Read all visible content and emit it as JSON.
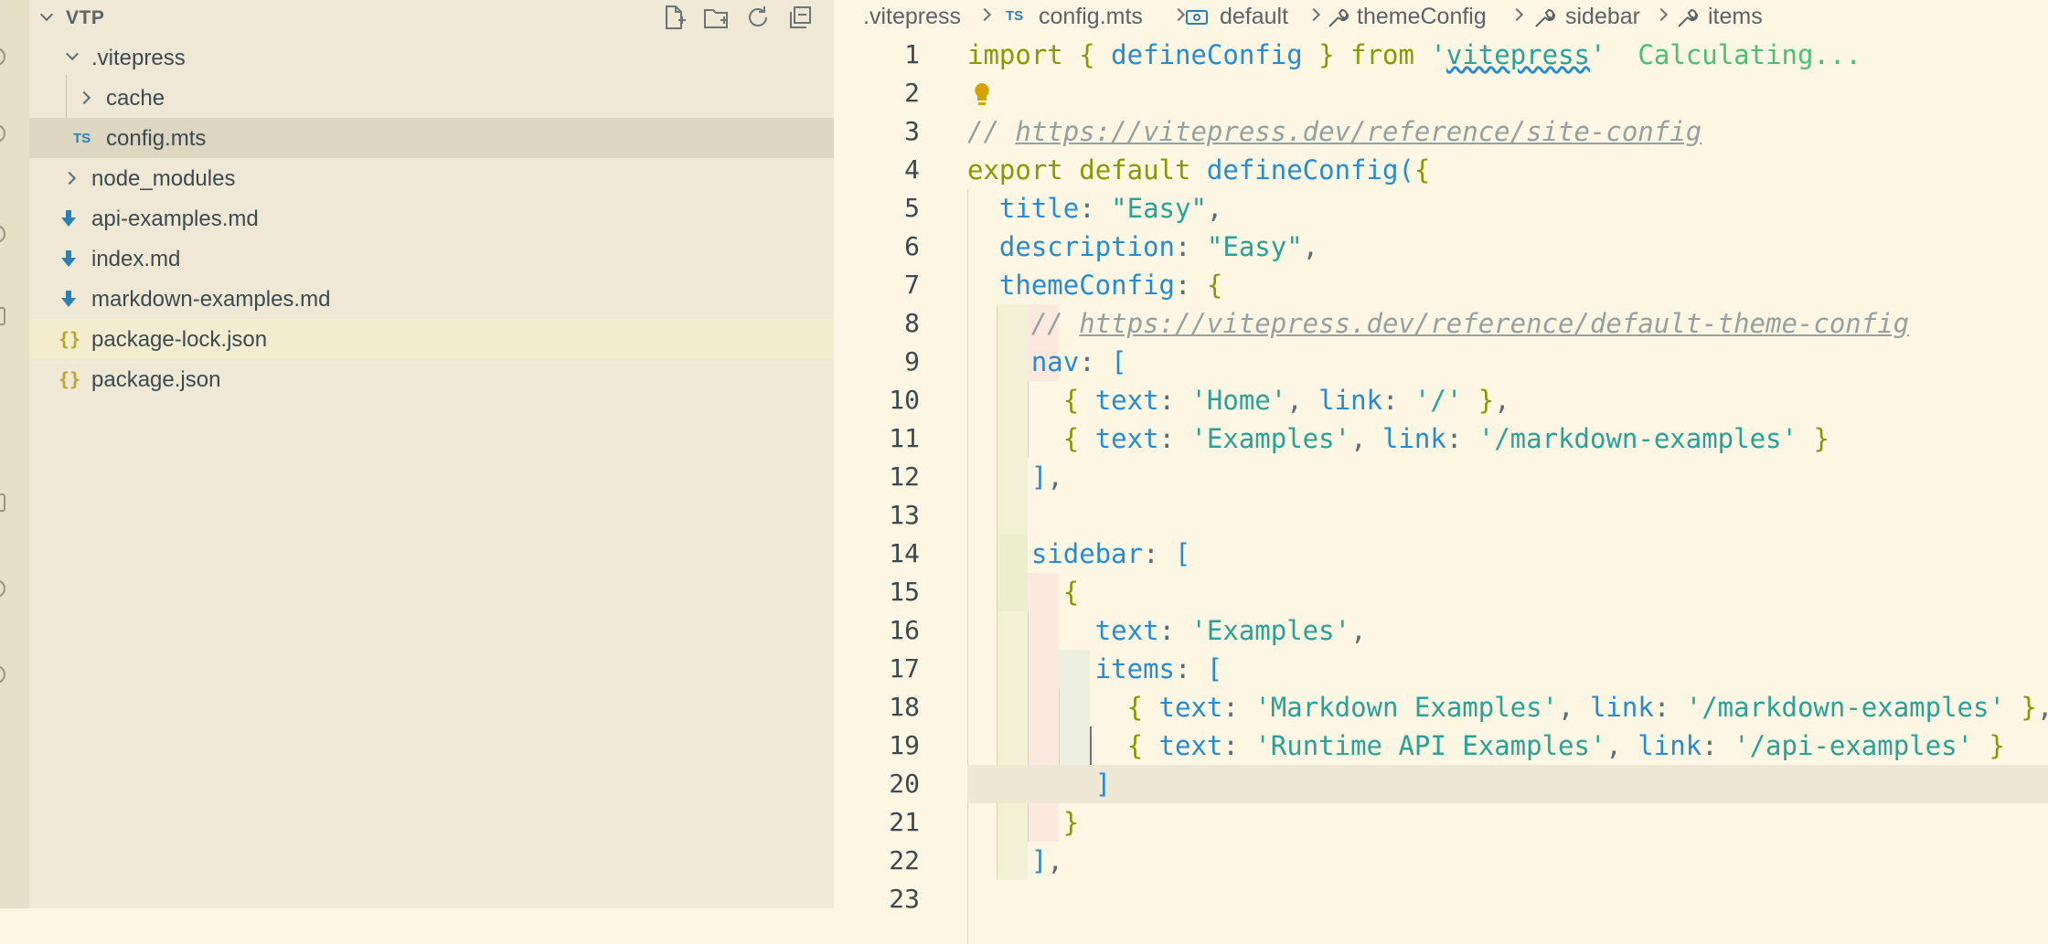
{
  "explorer": {
    "title": "VTP",
    "items": [
      {
        "label": ".vitepress",
        "kind": "folder-open"
      },
      {
        "label": "cache",
        "kind": "folder-closed"
      },
      {
        "label": "config.mts",
        "kind": "ts",
        "badge": "TS"
      },
      {
        "label": "node_modules",
        "kind": "folder-closed"
      },
      {
        "label": "api-examples.md",
        "kind": "md"
      },
      {
        "label": "index.md",
        "kind": "md"
      },
      {
        "label": "markdown-examples.md",
        "kind": "md"
      },
      {
        "label": "package-lock.json",
        "kind": "json",
        "badge": "{}"
      },
      {
        "label": "package.json",
        "kind": "json",
        "badge": "{}"
      }
    ]
  },
  "breadcrumb": {
    "items": [
      ".vitepress",
      "config.mts",
      "default",
      "themeConfig",
      "sidebar",
      "items"
    ],
    "ts_badge": "TS"
  },
  "editor": {
    "line_numbers": [
      "1",
      "2",
      "3",
      "4",
      "5",
      "6",
      "7",
      "8",
      "9",
      "10",
      "11",
      "12",
      "13",
      "14",
      "15",
      "16",
      "17",
      "18",
      "19",
      "20",
      "21",
      "22",
      "23"
    ],
    "lines": [
      "import { defineConfig } from 'vitepress'",
      "",
      "// https://vitepress.dev/reference/site-config",
      "export default defineConfig({",
      "  title: \"Easy\",",
      "  description: \"Easy\",",
      "  themeConfig: {",
      "    // https://vitepress.dev/reference/default-theme-config",
      "    nav: [",
      "      { text: 'Home', link: '/' },",
      "      { text: 'Examples', link: '/markdown-examples' }",
      "    ],",
      "",
      "    sidebar: [",
      "      {",
      "        text: 'Examples',",
      "        items: [",
      "          { text: 'Markdown Examples', link: '/markdown-examples' },",
      "          { text: 'Runtime API Examples', link: '/api-examples' }",
      "        ]",
      "      }",
      "    ],",
      ""
    ],
    "inline_hint": "Calculating...",
    "current_line": 20
  },
  "colors": {
    "keyword": "#859900",
    "function": "#268bd2",
    "string": "#2aa198",
    "comment": "#93a1a1",
    "background": "#fdf6e3",
    "sidebar": "#eee8d5"
  }
}
